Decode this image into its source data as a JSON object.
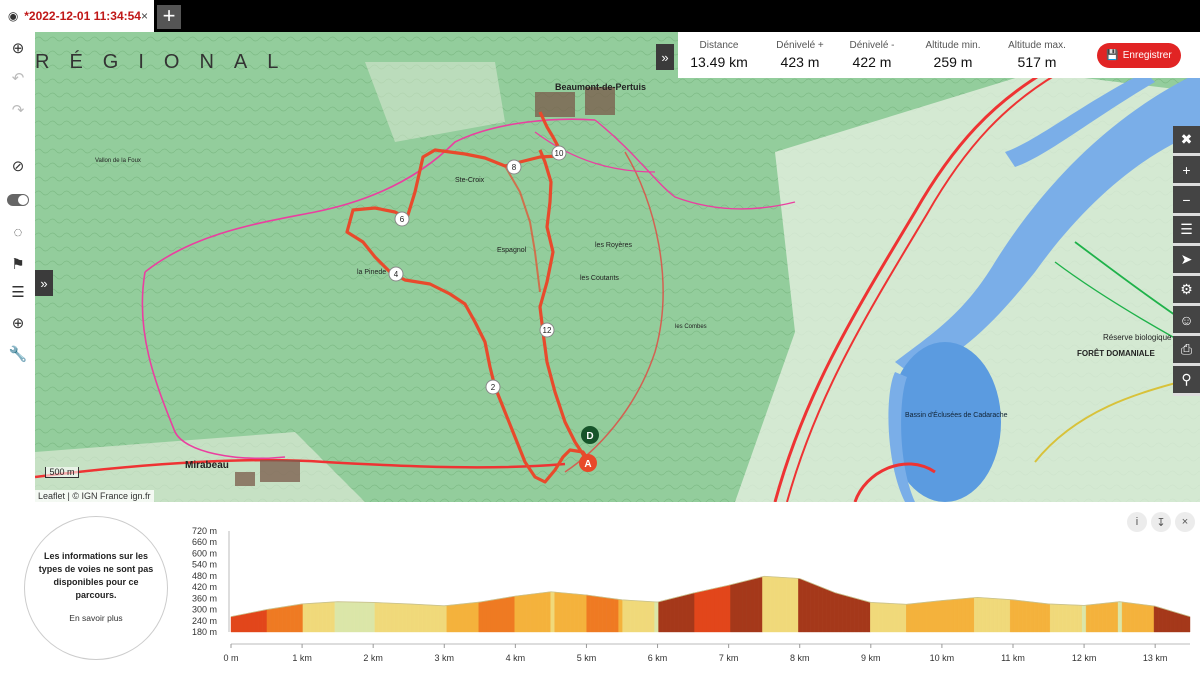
{
  "tab": {
    "title": "*2022-12-01 11:34:54",
    "close": "×",
    "new_tab": "+"
  },
  "stats": {
    "distance": {
      "label": "Distance",
      "value": "13.49 km"
    },
    "gain": {
      "label": "Dénivelé +",
      "value": "423 m"
    },
    "loss": {
      "label": "Dénivelé -",
      "value": "422 m"
    },
    "alt_min": {
      "label": "Altitude min.",
      "value": "259 m"
    },
    "alt_max": {
      "label": "Altitude max.",
      "value": "517 m"
    }
  },
  "record_button": "Enregistrer",
  "map": {
    "attribution": "Leaflet | © IGN France ign.fr",
    "scale": "500 m",
    "labels": [
      "RÉGIONAL",
      "Beaumont-de-Pertuis",
      "Mirabeau",
      "Bassin d'Éclusées de Cadarache",
      "Réserve biologique de",
      "FORÊT DOMANIALE",
      "Ste-Croix",
      "la Pinede",
      "les Royères",
      "les Coutants",
      "Espagnol",
      "Vallon de la Foux",
      "les Combes"
    ],
    "markers": [
      "10",
      "8",
      "6",
      "4",
      "12",
      "2"
    ],
    "start_marker": "A",
    "end_marker": "D"
  },
  "sidebar_icons": [
    "zoom-extent-icon",
    "undo-icon",
    "redo-icon",
    "no-entry-icon",
    "toggle-icon",
    "hide-icon",
    "route-icon",
    "menu-icon",
    "add-location-icon",
    "wrench-icon"
  ],
  "right_tools": [
    "compress-icon",
    "zoom-in-icon",
    "zoom-out-icon",
    "layers-icon",
    "locate-icon",
    "adjust-icon",
    "person-icon",
    "print-icon",
    "pin-icon"
  ],
  "info_panel": {
    "message": "Les informations sur les types de voies ne sont pas disponibles pour ce parcours.",
    "link": "En savoir plus"
  },
  "chart_data": {
    "type": "area",
    "title": "",
    "xlabel": "",
    "ylabel": "",
    "x_ticks": [
      "0 m",
      "1 km",
      "2 km",
      "3 km",
      "4 km",
      "5 km",
      "6 km",
      "7 km",
      "8 km",
      "9 km",
      "10 km",
      "11 km",
      "12 km",
      "13 km"
    ],
    "y_ticks": [
      "720 m",
      "660 m",
      "600 m",
      "540 m",
      "480 m",
      "420 m",
      "360 m",
      "300 m",
      "240 m",
      "180 m"
    ],
    "xlim": [
      0,
      13.49
    ],
    "ylim": [
      180,
      720
    ],
    "x": [
      0,
      0.5,
      1.0,
      1.5,
      2.0,
      2.5,
      3.0,
      3.5,
      4.0,
      4.5,
      5.0,
      5.5,
      6.0,
      6.5,
      7.0,
      7.5,
      8.0,
      8.5,
      9.0,
      9.5,
      10.0,
      10.5,
      11.0,
      11.5,
      12.0,
      12.5,
      13.0,
      13.49
    ],
    "elevation": [
      262,
      300,
      330,
      342,
      338,
      330,
      320,
      340,
      372,
      395,
      378,
      352,
      340,
      388,
      430,
      478,
      466,
      390,
      338,
      328,
      348,
      365,
      352,
      330,
      322,
      342,
      318,
      262
    ]
  }
}
